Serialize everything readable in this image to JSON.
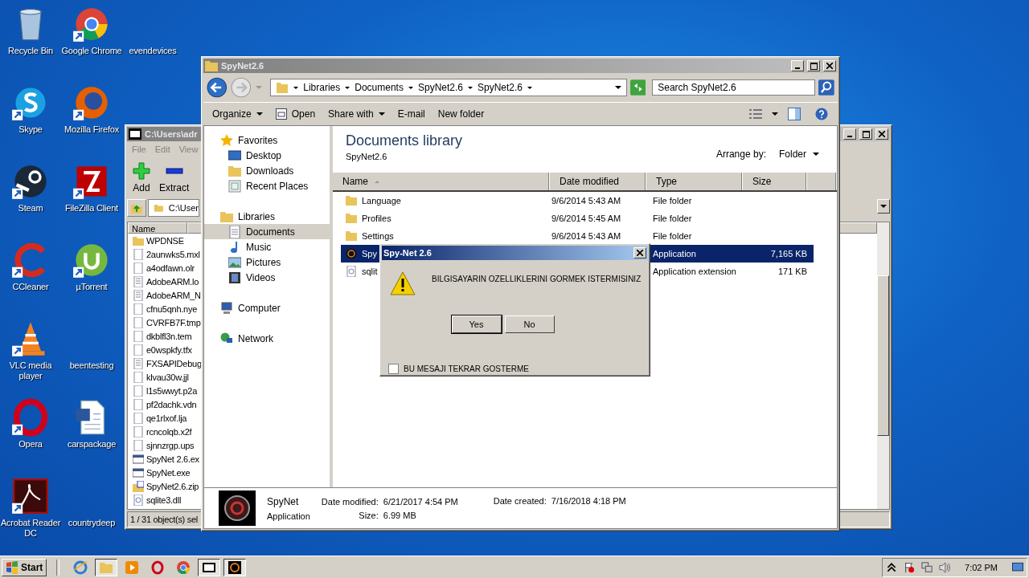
{
  "desktop_icons": [
    {
      "label": "Recycle Bin",
      "kind": "trash",
      "shortcut": false
    },
    {
      "label": "Skype",
      "kind": "skype",
      "shortcut": true
    },
    {
      "label": "Steam",
      "kind": "steam",
      "shortcut": true
    },
    {
      "label": "CCleaner",
      "kind": "ccleaner",
      "shortcut": true
    },
    {
      "label": "VLC media player",
      "kind": "vlc",
      "shortcut": true
    },
    {
      "label": "Opera",
      "kind": "opera",
      "shortcut": true
    },
    {
      "label": "Acrobat Reader DC",
      "kind": "acrobat",
      "shortcut": true
    },
    {
      "label": "Google Chrome",
      "kind": "chrome",
      "shortcut": true
    },
    {
      "label": "Mozilla Firefox",
      "kind": "firefox",
      "shortcut": true
    },
    {
      "label": "FileZilla Client",
      "kind": "filezilla",
      "shortcut": true
    },
    {
      "label": "µTorrent",
      "kind": "utorrent",
      "shortcut": true
    },
    {
      "label": "beentesting",
      "kind": "blank"
    },
    {
      "label": "carspackage",
      "kind": "word",
      "shortcut": false
    },
    {
      "label": "countrydeep",
      "kind": "blank"
    },
    {
      "label": "evendevices",
      "kind": "blank"
    }
  ],
  "zip_window": {
    "title": "C:\\Users\\adr",
    "menu": [
      "File",
      "Edit",
      "View"
    ],
    "tools": [
      {
        "label": "Add",
        "kind": "add"
      },
      {
        "label": "Extract",
        "kind": "extract"
      }
    ],
    "path": "C:\\User",
    "column": "Name",
    "files": [
      {
        "name": "WPDNSE",
        "kind": "folder"
      },
      {
        "name": "2aunwks5.mxl",
        "kind": "file"
      },
      {
        "name": "a4odfawn.olr",
        "kind": "file"
      },
      {
        "name": "AdobeARM.lo",
        "kind": "text"
      },
      {
        "name": "AdobeARM_N",
        "kind": "text"
      },
      {
        "name": "cfnu5qnh.nye",
        "kind": "file"
      },
      {
        "name": "CVRFB7F.tmp",
        "kind": "file"
      },
      {
        "name": "dkblfl3n.tem",
        "kind": "file"
      },
      {
        "name": "e0wspkfy.tfx",
        "kind": "file"
      },
      {
        "name": "FXSAPIDebug",
        "kind": "text"
      },
      {
        "name": "klvau30w.jjl",
        "kind": "file"
      },
      {
        "name": "l1s5wwyt.p2a",
        "kind": "file"
      },
      {
        "name": "pf2dachk.vdn",
        "kind": "file"
      },
      {
        "name": "qe1rlxof.lja",
        "kind": "file"
      },
      {
        "name": "rcncolqb.x2f",
        "kind": "file"
      },
      {
        "name": "sjnnzrgp.ups",
        "kind": "file"
      },
      {
        "name": "SpyNet 2.6.ex",
        "kind": "exe"
      },
      {
        "name": "SpyNet.exe",
        "kind": "exe"
      },
      {
        "name": "SpyNet2.6.zip",
        "kind": "zip"
      },
      {
        "name": "sqlite3.dll",
        "kind": "dll"
      }
    ],
    "status": "1 / 31 object(s) sel"
  },
  "explorer": {
    "title": "SpyNet2.6",
    "breadcrumb": [
      "Libraries",
      "Documents",
      "SpyNet2.6",
      "SpyNet2.6"
    ],
    "search": {
      "placeholder": "Search SpyNet2.6"
    },
    "toolbar": [
      {
        "label": "Organize",
        "kind": "menu"
      },
      {
        "label": "Open",
        "kind": "open"
      },
      {
        "label": "Share with",
        "kind": "menu"
      },
      {
        "label": "E-mail",
        "kind": "plain"
      },
      {
        "label": "New folder",
        "kind": "plain"
      }
    ],
    "nav": [
      {
        "label": "Favorites",
        "kind": "star",
        "selected": false,
        "children": [
          {
            "label": "Desktop",
            "kind": "desktop",
            "selected": false
          },
          {
            "label": "Downloads",
            "kind": "folder",
            "selected": false
          },
          {
            "label": "Recent Places",
            "kind": "places",
            "selected": false
          }
        ]
      },
      {
        "label": "Libraries",
        "kind": "library",
        "selected": false,
        "children": [
          {
            "label": "Documents",
            "kind": "doc",
            "selected": true
          },
          {
            "label": "Music",
            "kind": "music",
            "selected": false
          },
          {
            "label": "Pictures",
            "kind": "picture",
            "selected": false
          },
          {
            "label": "Videos",
            "kind": "video",
            "selected": false
          }
        ]
      },
      {
        "label": "Computer",
        "kind": "computer",
        "selected": false
      },
      {
        "label": "Network",
        "kind": "network",
        "selected": false
      }
    ],
    "library_title": "Documents library",
    "library_path": "SpyNet2.6",
    "arrange_label": "Arrange by:",
    "arrange_value": "Folder",
    "columns": [
      "Name",
      "Date modified",
      "Type",
      "Size"
    ],
    "rows": [
      {
        "name": "Language",
        "date": "9/6/2014 5:43 AM",
        "type": "File folder",
        "kind": "folder",
        "selected": false
      },
      {
        "name": "Profiles",
        "date": "9/6/2014 5:45 AM",
        "type": "File folder",
        "kind": "folder",
        "selected": false
      },
      {
        "name": "Settings",
        "date": "9/6/2014 5:43 AM",
        "type": "File folder",
        "kind": "folder",
        "selected": false
      },
      {
        "name": "Spy",
        "type": "Application",
        "size": "7,165 KB",
        "kind": "app",
        "selected": true
      },
      {
        "name": "sqlit",
        "type": "Application extension",
        "size": "171 KB",
        "kind": "dll",
        "selected": false
      }
    ],
    "details": {
      "name": "SpyNet",
      "type": "Application",
      "modified_label": "Date modified:",
      "modified": "6/21/2017 4:54 PM",
      "created_label": "Date created:",
      "created": "7/16/2018 4:18 PM",
      "size_label": "Size:",
      "size": "6.99 MB"
    }
  },
  "dialog": {
    "title": "Spy-Net 2.6",
    "message": "BILGISAYARIN OZELLIKLERINI GORMEK ISTERMISINIZ",
    "buttons": [
      {
        "label": "Yes",
        "default": true
      },
      {
        "label": "No",
        "default": false
      }
    ],
    "checkbox": {
      "label": "BU MESAJI TEKRAR GOSTERME",
      "checked": false
    }
  },
  "taskbar": {
    "start": "Start",
    "apps": [
      {
        "kind": "ie",
        "open": false
      },
      {
        "kind": "folder",
        "open": true
      },
      {
        "kind": "media",
        "open": false
      },
      {
        "kind": "opera",
        "open": false
      },
      {
        "kind": "chrome",
        "open": false
      },
      {
        "kind": "archive",
        "open": true
      },
      {
        "kind": "spynet",
        "open": true
      }
    ],
    "time": "7:02 PM"
  }
}
